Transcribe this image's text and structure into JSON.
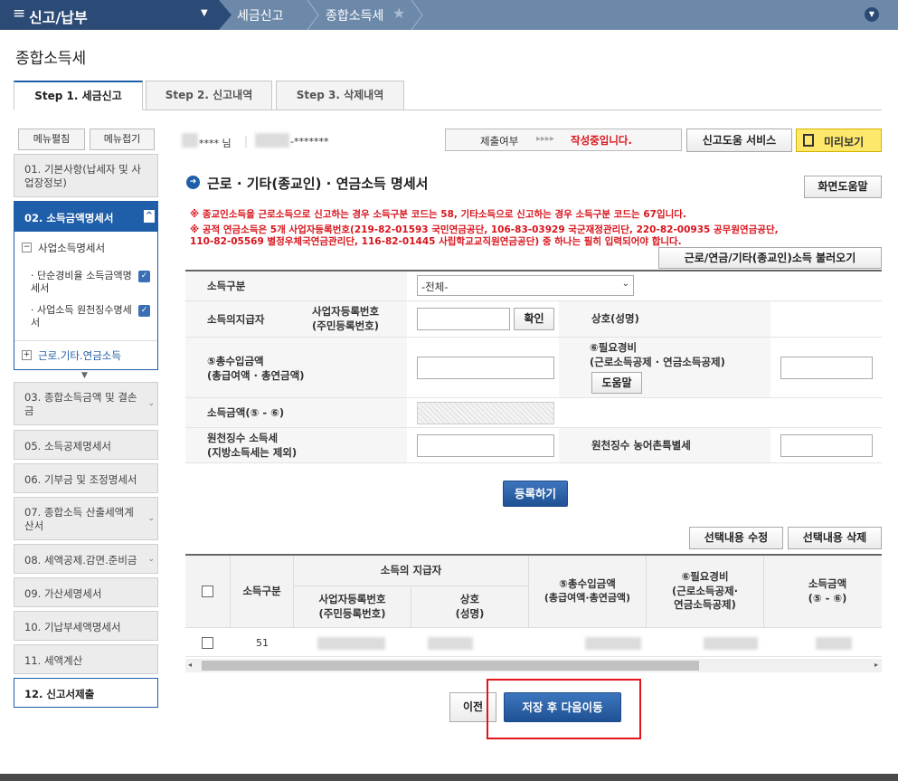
{
  "topnav": {
    "menu_label": "신고/납부",
    "crumb1": "세금신고",
    "crumb2": "종합소득세"
  },
  "page_title": "종합소득세",
  "tabs": [
    "Step 1. 세금신고",
    "Step 2. 신고내역",
    "Step 3. 삭제내역"
  ],
  "sidebar": {
    "expand_btn": "메뉴펼침",
    "collapse_btn": "메뉴접기",
    "items": [
      {
        "label": "01. 기본사항(납세자 및 사업장정보)"
      },
      {
        "label": "02. 소득금액명세서"
      },
      {
        "label": "03. 종합소득금액 및 결손금"
      },
      {
        "label": "05. 소득공제명세서"
      },
      {
        "label": "06. 기부금 및 조정명세서"
      },
      {
        "label": "07. 종합소득 산출세액계산서"
      },
      {
        "label": "08. 세액공제.감면.준비금"
      },
      {
        "label": "09. 가산세명세서"
      },
      {
        "label": "10. 기납부세액명세서"
      },
      {
        "label": "11. 세액계산"
      },
      {
        "label": "12. 신고서제출"
      }
    ],
    "sub": {
      "group": "사업소득명세서",
      "item1": "단순경비율 소득금액명세서",
      "item2": "사업소득 원천징수명세서",
      "item3": "근로.기타.연금소득"
    }
  },
  "user": {
    "name_suffix": "**** 님",
    "id_mask": "-*******"
  },
  "status": {
    "label": "제출여부",
    "arrows": "▸▸▸▸",
    "value": "작성중입니다."
  },
  "buttons": {
    "help_service": "신고도움 서비스",
    "preview": "미리보기",
    "screen_help": "화면도움말",
    "load": "근로/연금/기타(종교인)소득 불러오기",
    "confirm": "확인",
    "help": "도움말",
    "register": "등록하기",
    "edit_sel": "선택내용 수정",
    "del_sel": "선택내용 삭제",
    "prev": "이전",
    "save_next": "저장 후 다음이동"
  },
  "section_title": "근로 · 기타(종교인) · 연금소득 명세서",
  "notices": [
    "※ 종교인소득을 근로소득으로 신고하는 경우 소득구분 코드는 58, 기타소득으로 신고하는 경우 소득구분 코드는 67입니다.",
    "※ 공적 연금소득은 5개 사업자등록번호(219-82-01593 국민연금공단, 106-83-03929 국군재정관리단, 220-82-00935 공무원연금공단,",
    "110-82-05569 별정우체국연금관리단, 116-82-01445 사립학교교직원연금공단) 중 하나는 필히 입력되어야 합니다."
  ],
  "form": {
    "income_type_label": "소득구분",
    "income_type_value": "-전체-",
    "payer_label": "소득의지급자",
    "bizno_label1": "사업자등록번호",
    "bizno_label2": "(주민등록번호)",
    "trade_label": "상호(성명)",
    "total_label1": "⑤총수입금액",
    "total_label2": "(총급여액 · 총연금액)",
    "exp_label1": "⑥필요경비",
    "exp_label2": "(근로소득공제 · 연금소득공제)",
    "amount_label": "소득금액(⑤ - ⑥)",
    "wh_label1": "원천징수 소득세",
    "wh_label2": "(지방소득세는 제외)",
    "rural_label": "원천징수 농어촌특별세"
  },
  "table": {
    "h_type": "소득구분",
    "h_payer": "소득의 지급자",
    "h_bizno1": "사업자등록번호",
    "h_bizno2": "(주민등록번호)",
    "h_name1": "상호",
    "h_name2": "(성명)",
    "h_total1": "⑤총수입금액",
    "h_total2": "(총급여액·총연금액)",
    "h_exp1": "⑥필요경비",
    "h_exp2": "(근로소득공제·",
    "h_exp3": "연금소득공제)",
    "h_amt1": "소득금액",
    "h_amt2": "(⑤ - ⑥)",
    "rows": [
      {
        "type": "51"
      }
    ]
  }
}
